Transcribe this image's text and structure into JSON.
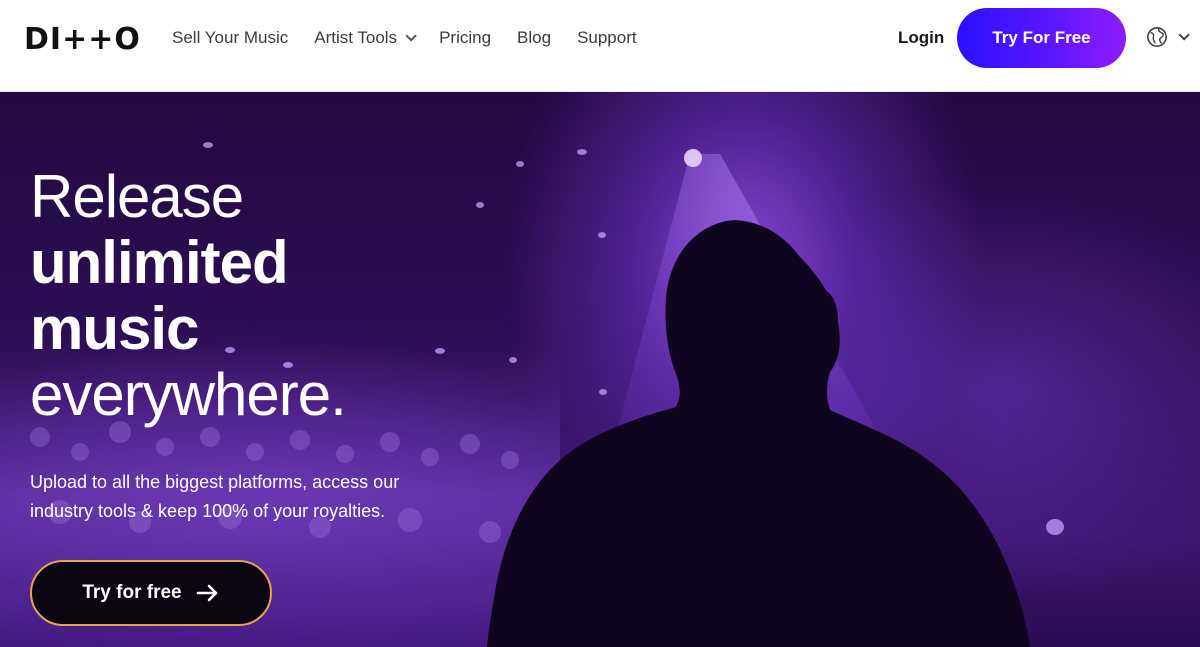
{
  "header": {
    "logo_text": "DI++O",
    "nav": [
      {
        "label": "Sell Your Music",
        "has_dropdown": false
      },
      {
        "label": "Artist Tools",
        "has_dropdown": true
      },
      {
        "label": "Pricing",
        "has_dropdown": false
      },
      {
        "label": "Blog",
        "has_dropdown": false
      },
      {
        "label": "Support",
        "has_dropdown": false
      }
    ],
    "login_label": "Login",
    "cta_label": "Try For Free",
    "language_icon": "globe-icon"
  },
  "hero": {
    "headline_line1": "Release",
    "headline_line2": "unlimited",
    "headline_line3": "music",
    "headline_line4": "everywhere.",
    "subtext_line1": "Upload to all the biggest platforms, access our",
    "subtext_line2": "industry tools & keep 100% of your royalties.",
    "cta_label": "Try for free",
    "cta_icon": "arrow-right-icon"
  },
  "colors": {
    "cta_gradient_start": "#2a10ff",
    "cta_gradient_end": "#8f1cff",
    "hero_purple": "#2c0f55",
    "hero_button_border": "#e2a64f"
  }
}
